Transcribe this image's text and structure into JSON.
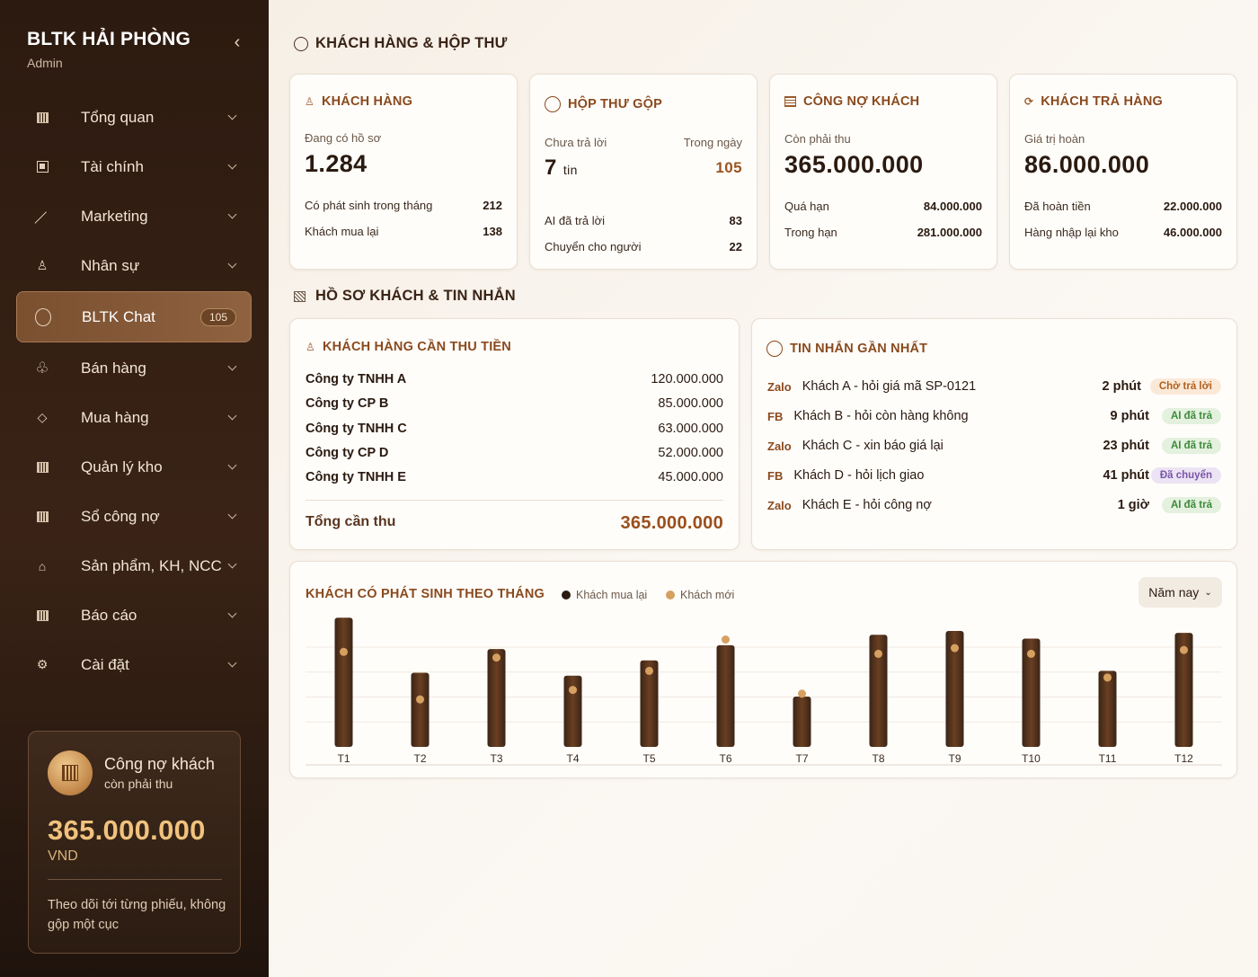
{
  "sidebar": {
    "brand": "BLTK HẢI PHÒNG",
    "role": "Admin",
    "items": [
      {
        "label": "Tổng quan",
        "icon": "grid-icon"
      },
      {
        "label": "Tài chính",
        "icon": "wallet-icon"
      },
      {
        "label": "Marketing",
        "icon": "trend-icon"
      },
      {
        "label": "Nhân sự",
        "icon": "person-icon"
      },
      {
        "label": "BLTK Chat",
        "icon": "chat-icon",
        "badge": "105",
        "active": true
      },
      {
        "label": "Bán hàng",
        "icon": "clover-icon"
      },
      {
        "label": "Mua hàng",
        "icon": "diamond-icon"
      },
      {
        "label": "Quản lý kho",
        "icon": "warehouse-icon"
      },
      {
        "label": "Sổ công nợ",
        "icon": "ledger-icon"
      },
      {
        "label": "Sản phẩm, KH, NCC",
        "icon": "home-icon"
      },
      {
        "label": "Báo cáo",
        "icon": "report-icon"
      },
      {
        "label": "Cài đặt",
        "icon": "gear-icon"
      }
    ],
    "debt_card": {
      "title": "Công nợ khách",
      "subtitle": "còn phải thu",
      "amount": "365.000.000",
      "currency": "VND",
      "note": "Theo dõi tới từng phiếu, không gộp một cục"
    }
  },
  "main": {
    "section1_title": "KHÁCH HÀNG & HỘP THƯ",
    "customers": {
      "title": "KHÁCH HÀNG",
      "label": "Đang có hồ sơ",
      "value": "1.284",
      "rows": [
        {
          "label": "Có phát sinh trong tháng",
          "value": "212"
        },
        {
          "label": "Khách mua lại",
          "value": "138"
        }
      ]
    },
    "inbox": {
      "title": "HỘP THƯ GỘP",
      "label_left": "Chưa trả lời",
      "label_right": "Trong ngày",
      "value": "7",
      "unit": "tin",
      "value_right": "105",
      "rows": [
        {
          "label": "AI đã trả lời",
          "value": "83"
        },
        {
          "label": "Chuyển cho người",
          "value": "22"
        }
      ]
    },
    "receivable": {
      "title": "CÔNG NỢ KHÁCH",
      "label": "Còn phải thu",
      "value": "365.000.000",
      "rows": [
        {
          "label": "Quá hạn",
          "value": "84.000.000"
        },
        {
          "label": "Trong hạn",
          "value": "281.000.000"
        }
      ]
    },
    "returns": {
      "title": "KHÁCH TRẢ HÀNG",
      "label": "Giá trị hoàn",
      "value": "86.000.000",
      "rows": [
        {
          "label": "Đã hoàn tiền",
          "value": "22.000.000"
        },
        {
          "label": "Hàng nhập lại kho",
          "value": "46.000.000"
        }
      ]
    },
    "section2_title": "HỒ SƠ KHÁCH & TIN NHẮN",
    "collect": {
      "title": "KHÁCH HÀNG CẦN THU TIỀN",
      "rows": [
        {
          "name": "Công ty TNHH A",
          "value": "120.000.000"
        },
        {
          "name": "Công ty CP B",
          "value": "85.000.000"
        },
        {
          "name": "Công ty TNHH C",
          "value": "63.000.000"
        },
        {
          "name": "Công ty CP D",
          "value": "52.000.000"
        },
        {
          "name": "Công ty TNHH E",
          "value": "45.000.000"
        }
      ],
      "total_label": "Tổng cần thu",
      "total_value": "365.000.000"
    },
    "messages": {
      "title": "TIN NHẮN GẦN NHẤT",
      "rows": [
        {
          "source": "Zalo",
          "text": "Khách A - hỏi giá mã SP-0121",
          "time": "2 phút",
          "status": "Chờ trả lời"
        },
        {
          "source": "FB",
          "text": "Khách B - hỏi còn hàng không",
          "time": "9 phút",
          "status": "AI đã trả"
        },
        {
          "source": "Zalo",
          "text": "Khách C - xin báo giá lại",
          "time": "23 phút",
          "status": "AI đã trả"
        },
        {
          "source": "FB",
          "text": "Khách D - hỏi lịch giao",
          "time": "41 phút",
          "status": "Đã chuyển"
        },
        {
          "source": "Zalo",
          "text": "Khách E - hỏi công nợ",
          "time": "1 giờ",
          "status": "AI đã trả"
        }
      ],
      "status_colors": {
        "Chờ trả lời": {
          "bg": "#fbe9d8",
          "fg": "#b0601f"
        },
        "AI đã trả": {
          "bg": "#e3f1de",
          "fg": "#3d8a3a"
        },
        "Đã chuyển": {
          "bg": "#ece4f4",
          "fg": "#7a55a8"
        }
      }
    }
  },
  "chart_data": {
    "type": "bar",
    "title": "KHÁCH CÓ PHÁT SINH THEO THÁNG",
    "categories": [
      "T1",
      "T2",
      "T3",
      "T4",
      "T5",
      "T6",
      "T7",
      "T8",
      "T9",
      "T10",
      "T11",
      "T12"
    ],
    "series": [
      {
        "name": "Khách mua lại",
        "color": "#2a1a10",
        "values": [
          136,
          78,
          103,
          75,
          91,
          107,
          53,
          118,
          122,
          114,
          80,
          120
        ]
      },
      {
        "name": "Khách mới",
        "color": "#d6a060",
        "values": [
          100,
          50,
          94,
          60,
          80,
          113,
          56,
          98,
          104,
          98,
          73,
          102
        ]
      }
    ],
    "ylim": [
      0,
      140
    ],
    "grid": true,
    "legend": "top",
    "filter_label": "Năm nay"
  }
}
